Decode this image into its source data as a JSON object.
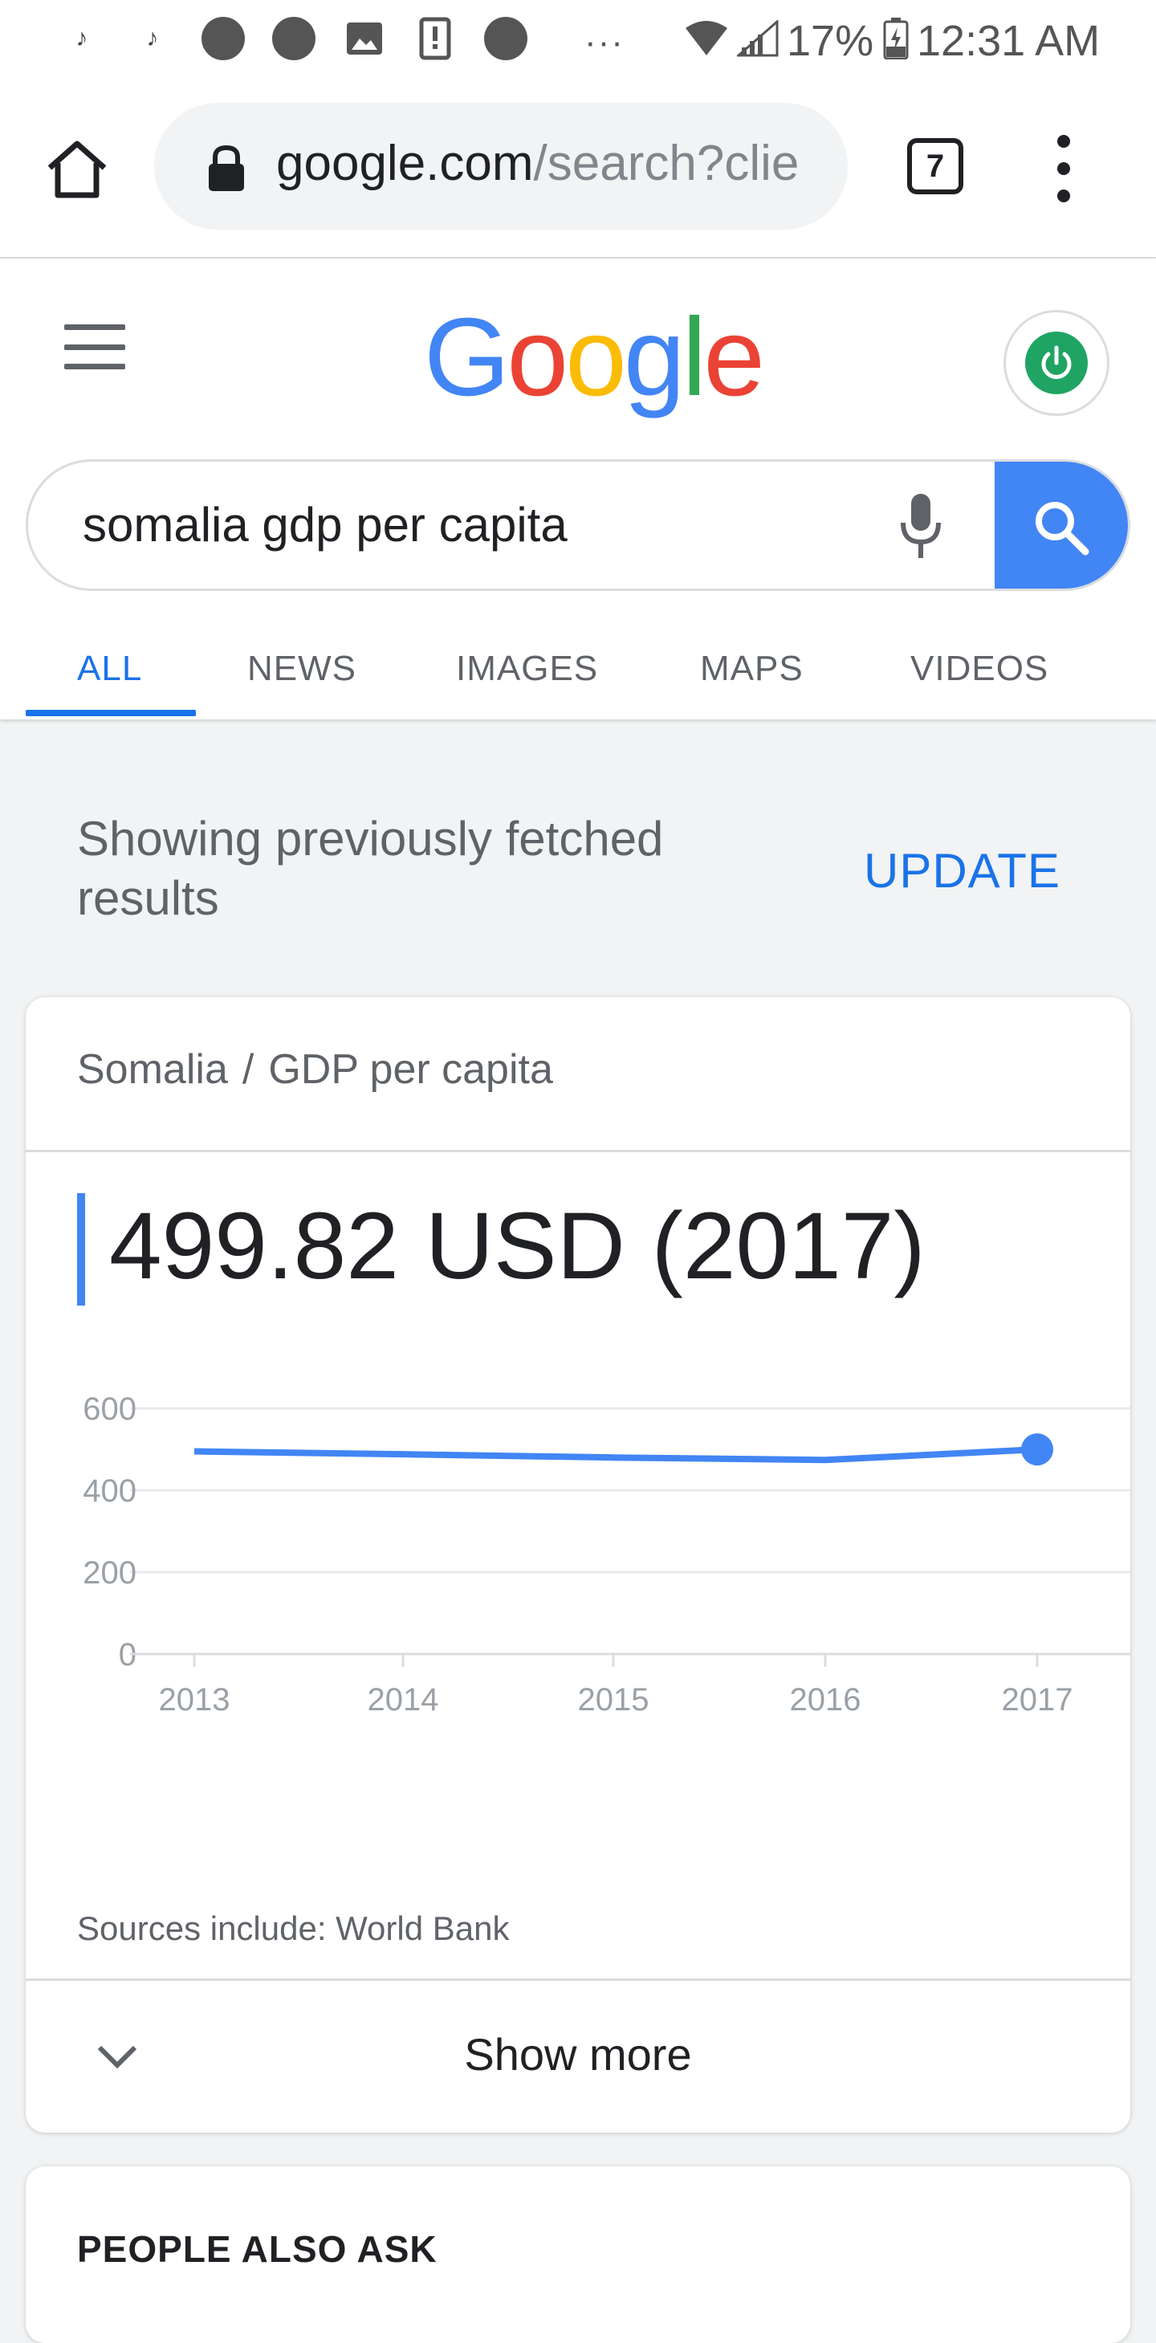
{
  "status_bar": {
    "icons": [
      "tiktok-icon",
      "tiktok-icon",
      "emoji-icon",
      "fire-icon",
      "gallery-icon",
      "phone-alert-icon",
      "emoji-icon",
      "more-dots-icon",
      "wifi-icon",
      "signal-icon",
      "battery-charging-icon"
    ],
    "battery": "17%",
    "time": "12:31 AM"
  },
  "browser": {
    "url_host": "google.com",
    "url_path": "/search?clie",
    "tab_count": "7"
  },
  "google": {
    "logo_letters": [
      {
        "ch": "G",
        "color": "#4285f4"
      },
      {
        "ch": "o",
        "color": "#ea4335"
      },
      {
        "ch": "o",
        "color": "#fbbc05"
      },
      {
        "ch": "g",
        "color": "#4285f4"
      },
      {
        "ch": "l",
        "color": "#34a853"
      },
      {
        "ch": "e",
        "color": "#ea4335"
      }
    ],
    "query": "somalia gdp per capita",
    "tabs": [
      "ALL",
      "NEWS",
      "IMAGES",
      "MAPS",
      "VIDEOS"
    ],
    "active_tab": "ALL"
  },
  "notice": {
    "text": "Showing previously fetched results",
    "action": "UPDATE"
  },
  "card": {
    "breadcrumb_country": "Somalia",
    "breadcrumb_separator": "/",
    "breadcrumb_metric": "GDP per capita",
    "headline_value": "499.82 USD (2017)",
    "source": "Sources include: World Bank",
    "show_more": "Show more"
  },
  "chart_data": {
    "type": "line",
    "title": "",
    "xlabel": "",
    "ylabel": "",
    "x": [
      "2013",
      "2014",
      "2015",
      "2016",
      "2017"
    ],
    "y_ticks": [
      "0",
      "200",
      "400",
      "600"
    ],
    "ylim": [
      0,
      600
    ],
    "grid": true,
    "series": [
      {
        "values": [
          495,
          488,
          480,
          474,
          499.82
        ],
        "color": "#4285f4"
      }
    ]
  },
  "people_also_ask": {
    "title": "PEOPLE ALSO ASK"
  },
  "colors": {
    "accent": "#1a73e8",
    "line": "#4285f4",
    "avatar": "#1fa463"
  }
}
